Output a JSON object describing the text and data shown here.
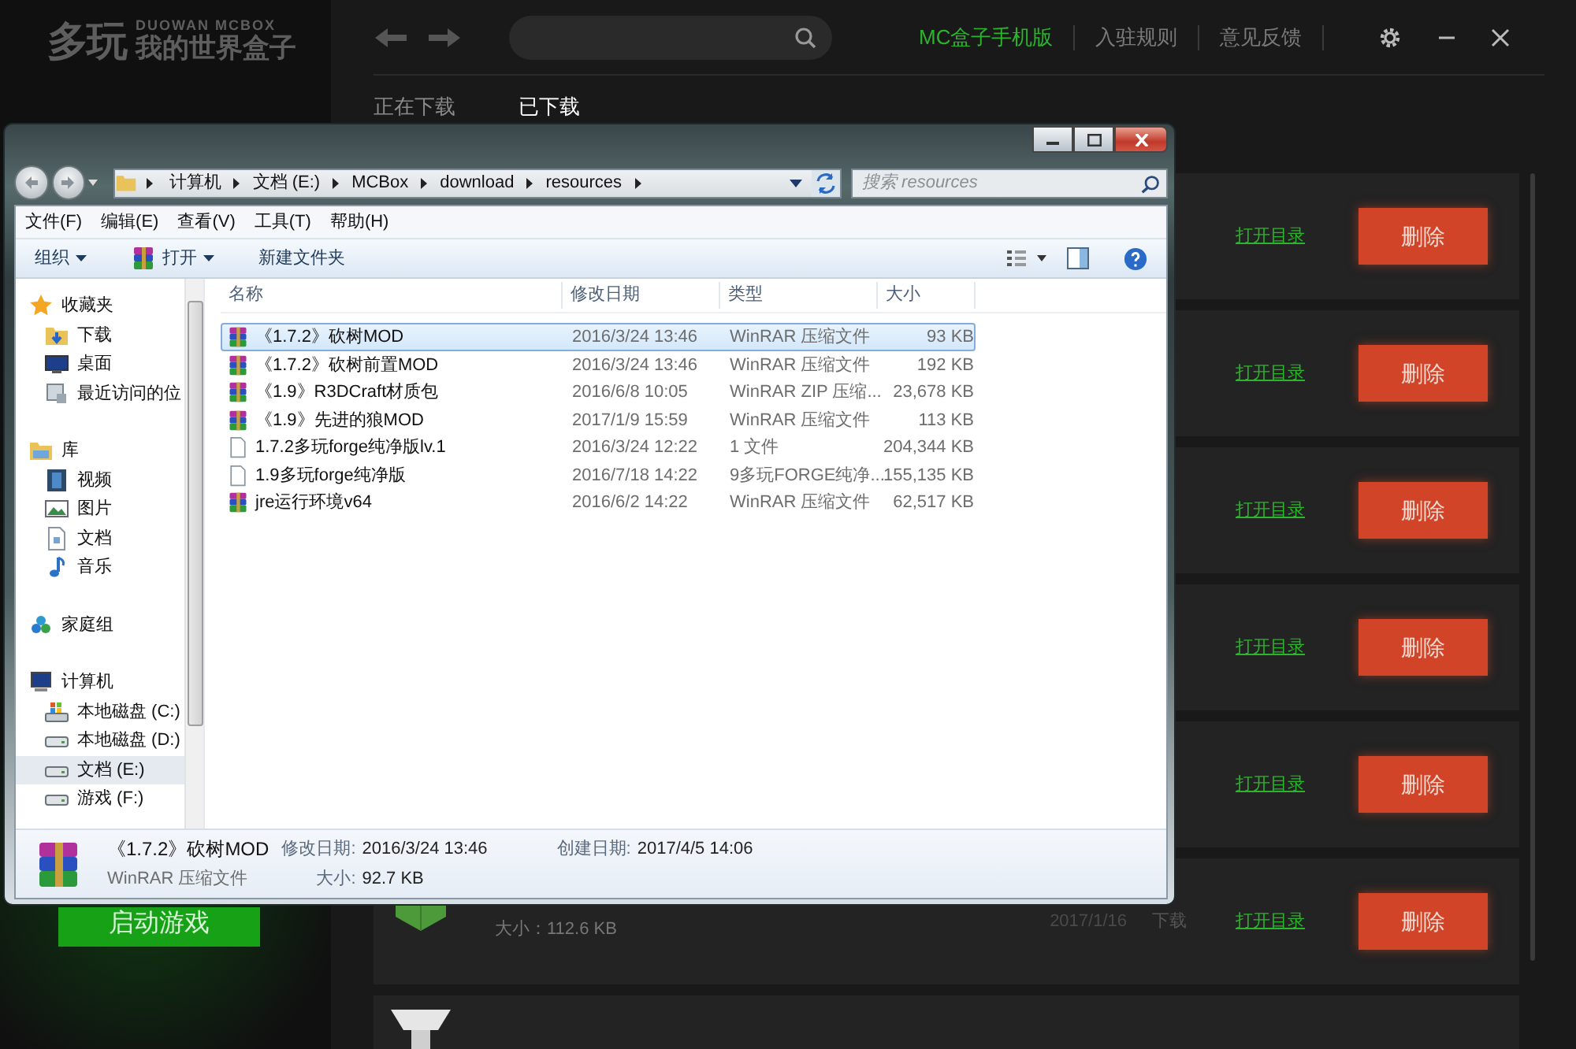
{
  "app": {
    "logo": {
      "mark": "多玩",
      "brand": "DUOWAN MCBOX",
      "title": "我的世界盒子"
    },
    "launch_button": "启动游戏",
    "header_links": [
      {
        "label": "MC盒子手机版",
        "kind": "mobile"
      },
      {
        "label": "入驻规则",
        "kind": "plain"
      },
      {
        "label": "意见反馈",
        "kind": "plain"
      }
    ],
    "tabs": [
      {
        "label": "正在下载",
        "selected": false
      },
      {
        "label": "已下载",
        "selected": true
      }
    ],
    "downloads": [
      {
        "kind": "covered",
        "open_link": "打开目录",
        "delete_button": "删除"
      },
      {
        "kind": "covered",
        "open_link": "打开目录",
        "delete_button": "删除"
      },
      {
        "kind": "covered",
        "open_link": "打开目录",
        "delete_button": "删除"
      },
      {
        "kind": "covered",
        "open_link": "打开目录",
        "delete_button": "删除"
      },
      {
        "kind": "covered",
        "open_link": "打开目录",
        "delete_button": "删除"
      },
      {
        "kind": "mod",
        "size": "大小：112.6 KB",
        "date": "2017/1/16",
        "status": "下载",
        "open_link": "打开目录",
        "delete_button": "删除"
      },
      {
        "kind": "forge"
      }
    ]
  },
  "explorer": {
    "breadcrumbs": [
      "计算机",
      "文档 (E:)",
      "MCBox",
      "download",
      "resources"
    ],
    "search": {
      "placeholder": "搜索 resources"
    },
    "menu": [
      "文件(F)",
      "编辑(E)",
      "查看(V)",
      "工具(T)",
      "帮助(H)"
    ],
    "toolbar": [
      {
        "label": "组织",
        "kind": "menu"
      },
      {
        "label": "打开",
        "kind": "open"
      },
      {
        "label": "新建文件夹",
        "kind": "plain"
      }
    ],
    "nav": [
      {
        "label": "收藏夹",
        "kind": "favorites",
        "selected": false,
        "children": [
          {
            "label": "下载",
            "kind": "downloads",
            "selected": false
          },
          {
            "label": "桌面",
            "kind": "desktop",
            "selected": false
          },
          {
            "label": "最近访问的位",
            "kind": "recent",
            "selected": false
          }
        ]
      },
      {
        "label": "库",
        "kind": "library",
        "selected": false,
        "children": [
          {
            "label": "视频",
            "kind": "videos",
            "selected": false
          },
          {
            "label": "图片",
            "kind": "pictures",
            "selected": false
          },
          {
            "label": "文档",
            "kind": "documents",
            "selected": false
          },
          {
            "label": "音乐",
            "kind": "music",
            "selected": false
          }
        ]
      },
      {
        "label": "家庭组",
        "kind": "homegroup",
        "selected": false
      },
      {
        "label": "计算机",
        "kind": "computer",
        "selected": false,
        "children": [
          {
            "label": "本地磁盘 (C:)",
            "kind": "system-drive",
            "selected": false
          },
          {
            "label": "本地磁盘 (D:)",
            "kind": "drive",
            "selected": false
          },
          {
            "label": "文档 (E:)",
            "kind": "drive",
            "selected": true
          },
          {
            "label": "游戏 (F:)",
            "kind": "drive",
            "selected": false
          }
        ]
      }
    ],
    "columns": [
      "名称",
      "修改日期",
      "类型",
      "大小"
    ],
    "files": [
      {
        "kind": "rar",
        "name": "《1.7.2》砍树MOD",
        "date": "2016/3/24 13:46",
        "type": "WinRAR 压缩文件",
        "size": "93 KB",
        "selected": true
      },
      {
        "kind": "rar",
        "name": "《1.7.2》砍树前置MOD",
        "date": "2016/3/24 13:46",
        "type": "WinRAR 压缩文件",
        "size": "192 KB",
        "selected": false
      },
      {
        "kind": "rar",
        "name": "《1.9》R3DCraft材质包",
        "date": "2016/6/8 10:05",
        "type": "WinRAR ZIP 压缩...",
        "size": "23,678 KB",
        "selected": false
      },
      {
        "kind": "rar",
        "name": "《1.9》先进的狼MOD",
        "date": "2017/1/9 15:59",
        "type": "WinRAR 压缩文件",
        "size": "113 KB",
        "selected": false
      },
      {
        "kind": "file",
        "name": "1.7.2多玩forge纯净版lv.1",
        "date": "2016/3/24 12:22",
        "type": "1 文件",
        "size": "204,344 KB",
        "selected": false
      },
      {
        "kind": "file",
        "name": "1.9多玩forge纯净版",
        "date": "2016/7/18 14:22",
        "type": "9多玩FORGE纯净...",
        "size": "155,135 KB",
        "selected": false
      },
      {
        "kind": "rar",
        "name": "jre运行环境v64",
        "date": "2016/6/2 14:22",
        "type": "WinRAR 压缩文件",
        "size": "62,517 KB",
        "selected": false
      }
    ],
    "details": {
      "name": "《1.7.2》砍树MOD",
      "type": "WinRAR 压缩文件",
      "fields": [
        {
          "label": "修改日期:",
          "value": "2016/3/24 13:46"
        },
        {
          "label": "创建日期:",
          "value": "2017/4/5 14:06"
        },
        {
          "label": "大小:",
          "value": "92.7 KB"
        }
      ]
    }
  }
}
